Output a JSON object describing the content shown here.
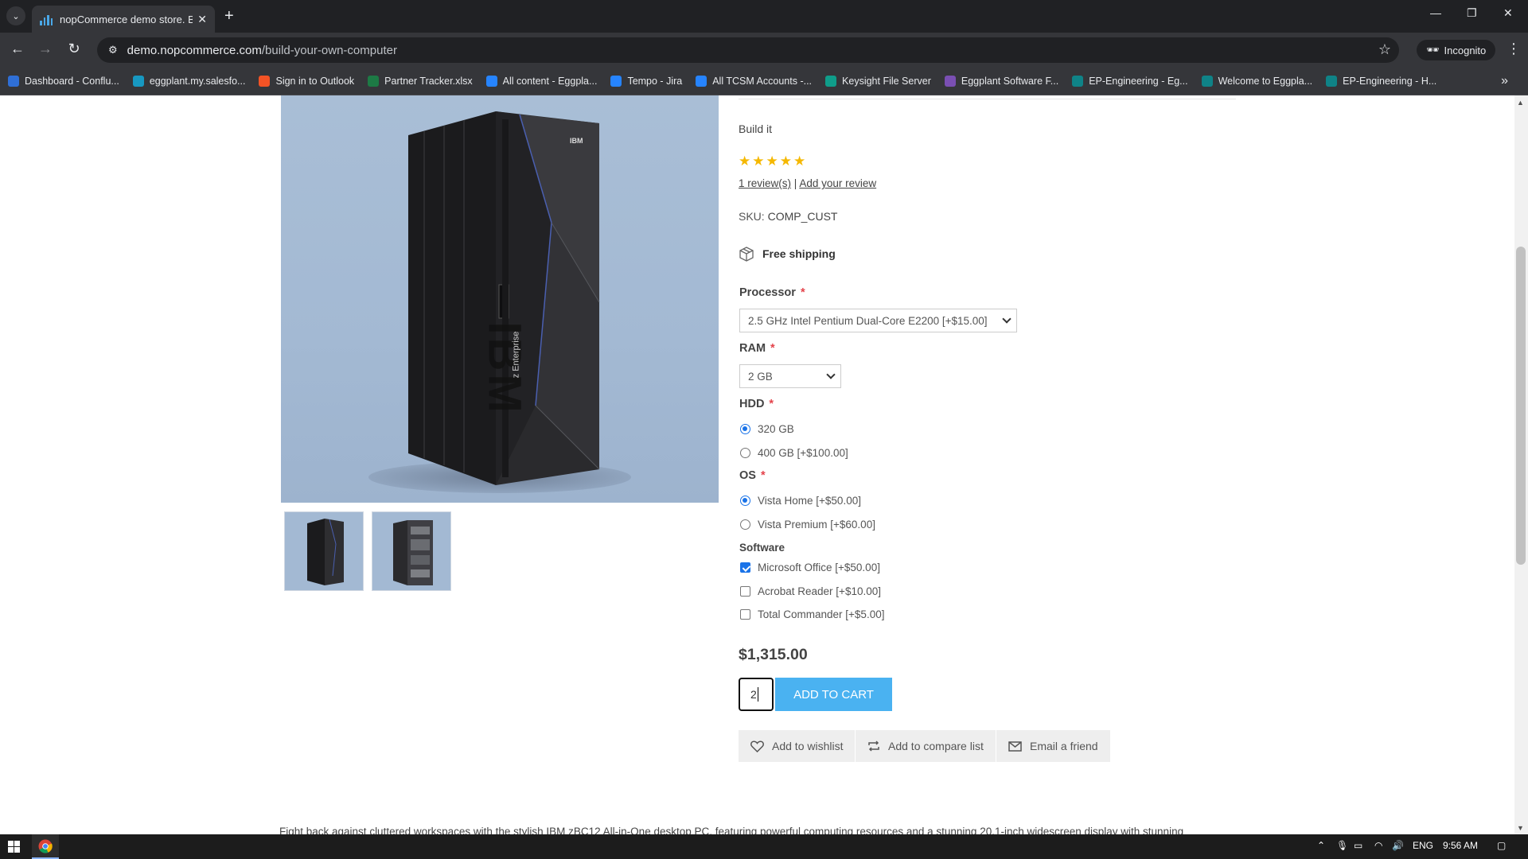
{
  "browser": {
    "tab_title": "nopCommerce demo store. Buil",
    "url_host": "demo.nopcommerce.com",
    "url_path": "/build-your-own-computer",
    "profile_label": "Incognito",
    "bookmarks": [
      {
        "label": "Dashboard - Conflu...",
        "icon": "confluence-icon",
        "color": "#2f6fd6"
      },
      {
        "label": "eggplant.my.salesfo...",
        "icon": "salesforce-icon",
        "color": "#1798c1"
      },
      {
        "label": "Sign in to Outlook",
        "icon": "microsoft-icon",
        "color": "#f35325"
      },
      {
        "label": "Partner Tracker.xlsx",
        "icon": "excel-icon",
        "color": "#1d7a45"
      },
      {
        "label": "All content - Eggpla...",
        "icon": "jira-icon",
        "color": "#2684ff"
      },
      {
        "label": "Tempo - Jira",
        "icon": "jira-icon",
        "color": "#2684ff"
      },
      {
        "label": "All TCSM Accounts -...",
        "icon": "jira-icon",
        "color": "#2684ff"
      },
      {
        "label": "Keysight File Server",
        "icon": "keysight-icon",
        "color": "#0f9d8a"
      },
      {
        "label": "Eggplant Software F...",
        "icon": "eggplant-icon",
        "color": "#7a4fb3"
      },
      {
        "label": "EP-Engineering - Eg...",
        "icon": "sharepoint-icon",
        "color": "#0f8387"
      },
      {
        "label": "Welcome to Eggpla...",
        "icon": "sharepoint-icon",
        "color": "#0f8387"
      },
      {
        "label": "EP-Engineering - H...",
        "icon": "sharepoint-icon",
        "color": "#0f8387"
      }
    ]
  },
  "product": {
    "short_description": "Build it",
    "rating_stars": 5,
    "reviews_link": "1 review(s)",
    "review_separator": "|",
    "add_review_link": "Add your review",
    "sku_label": "SKU:",
    "sku_value": "COMP_CUST",
    "shipping_text": "Free shipping",
    "price": "$1,315.00",
    "quantity": "2",
    "add_to_cart": "ADD TO CART",
    "add_to_wishlist": "Add to wishlist",
    "add_to_compare": "Add to compare list",
    "email_friend": "Email a friend",
    "long_description": "Fight back against cluttered workspaces with the stylish IBM zBC12 All-in-One desktop PC, featuring powerful computing resources and a stunning 20.1-inch widescreen display with stunning",
    "image_brand_text": "IBM",
    "image_model_text": "z Enterprise"
  },
  "attributes": {
    "required_marker": "*",
    "processor": {
      "label": "Processor",
      "selected": "2.5 GHz Intel Pentium Dual-Core E2200 [+$15.00]"
    },
    "ram": {
      "label": "RAM",
      "selected": "2 GB"
    },
    "hdd": {
      "label": "HDD",
      "options": [
        {
          "label": "320 GB",
          "checked": true
        },
        {
          "label": "400 GB [+$100.00]",
          "checked": false
        }
      ]
    },
    "os": {
      "label": "OS",
      "options": [
        {
          "label": "Vista Home [+$50.00]",
          "checked": true
        },
        {
          "label": "Vista Premium [+$60.00]",
          "checked": false
        }
      ]
    },
    "software": {
      "label": "Software",
      "options": [
        {
          "label": "Microsoft Office [+$50.00]",
          "checked": true
        },
        {
          "label": "Acrobat Reader [+$10.00]",
          "checked": false
        },
        {
          "label": "Total Commander [+$5.00]",
          "checked": false
        }
      ]
    }
  },
  "taskbar": {
    "language": "ENG",
    "time": "9:56 AM"
  },
  "colors": {
    "accent_button": "#4ab2f1",
    "star": "#f5b800",
    "required": "#e4434b"
  }
}
